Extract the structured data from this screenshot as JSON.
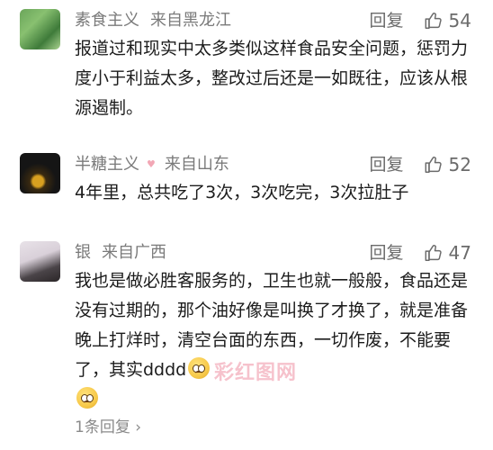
{
  "comments": [
    {
      "username": "素食主义",
      "location": "来自黑龙江",
      "reply_label": "回复",
      "likes": "54",
      "text": "报道过和现实中太多类似这样食品安全问题，惩罚力度小于利益太多，整改过后还是一如既往，应该从根源遏制。"
    },
    {
      "username": "半糖主义",
      "badge": "♥",
      "location": "来自山东",
      "reply_label": "回复",
      "likes": "52",
      "text": "4年里，总共吃了3次，3次吃完，3次拉肚子"
    },
    {
      "username": "银",
      "location": "来自广西",
      "reply_label": "回复",
      "likes": "47",
      "text": "我也是做必胜客服务的，卫生也就一般般，食品还是没有过期的，那个油好像是叫换了才换了，就是准备晚上打烊时，清空台面的东西，一切作废，不能要了，其实dddd",
      "replies_link": "1条回复 ›"
    }
  ],
  "watermark": "彩红图网",
  "icons": [
    "thumbs-up-icon",
    "smiley-emoji-icon"
  ]
}
